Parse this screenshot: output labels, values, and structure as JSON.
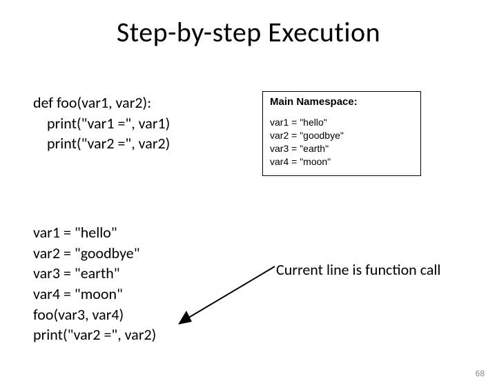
{
  "title": "Step-by-step Execution",
  "code_top": {
    "l1": "def foo(var1, var2):",
    "l2": "print(\"var1 =\", var1)",
    "l3": "print(\"var2 =\", var2)"
  },
  "code_bottom": {
    "l1": "var1 = \"hello\"",
    "l2": "var2 = \"goodbye\"",
    "l3": "var3 = \"earth\"",
    "l4": "var4 = \"moon\"",
    "l5": "foo(var3, var4)",
    "l6": "print(\"var2 =\", var2)"
  },
  "namespace": {
    "title": "Main Namespace:",
    "l1": "var1 = \"hello\"",
    "l2": "var2 = \"goodbye\"",
    "l3": "var3 = \"earth\"",
    "l4": "var4 = \"moon\""
  },
  "annotation": "Current line is function call",
  "pagenum": "68"
}
